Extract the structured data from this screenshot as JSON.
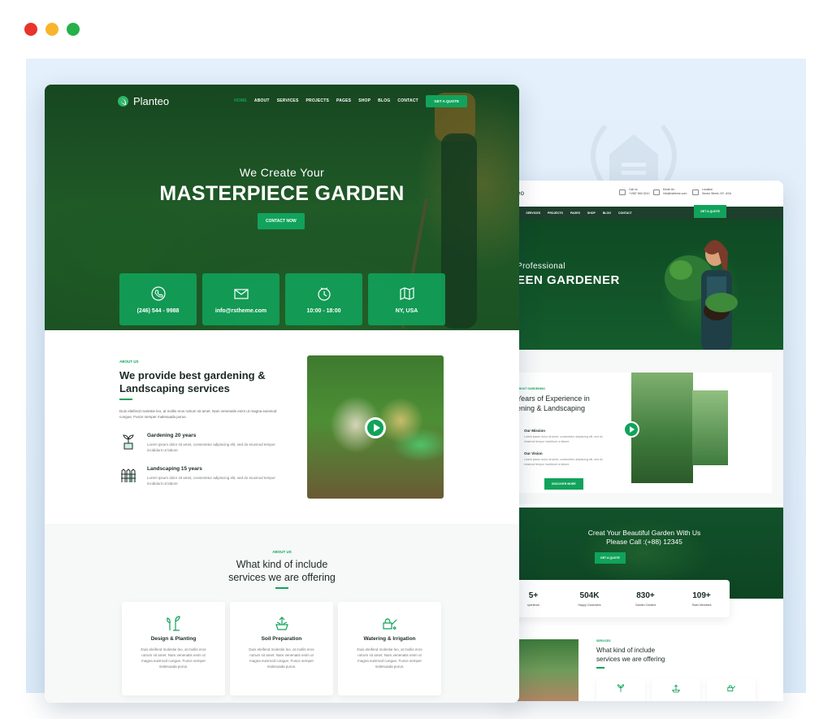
{
  "window": {
    "dots": [
      "#e9342b",
      "#f7b52c",
      "#26b14a"
    ]
  },
  "colors": {
    "accent": "#11a35b",
    "dark_green": "#0f4a24",
    "heading": "#1b2a24"
  },
  "main_site": {
    "brand": "Planteo",
    "nav": [
      "HOME",
      "ABOUT",
      "SERVICES",
      "PROJECTS",
      "PAGES",
      "SHOP",
      "BLOG",
      "CONTACT"
    ],
    "quote_button": "GET A QUOTE",
    "hero": {
      "subtitle": "We Create Your",
      "title": "MASTERPIECE GARDEN",
      "button": "CONTACT NOW"
    },
    "info_cards": [
      {
        "icon": "phone-icon",
        "text": "(246) 544 - 9988"
      },
      {
        "icon": "mail-icon",
        "text": "info@rstheme.com"
      },
      {
        "icon": "clock-icon",
        "text": "10:00 - 18:00"
      },
      {
        "icon": "map-icon",
        "text": "NY, USA"
      }
    ],
    "about": {
      "tag": "ABOUT US",
      "title": "We provide best gardening & Landscaping services",
      "text": "Duis eleifend molestie leo, at mollis eros rutrum sit amet. Nam venenatis enim ut magna euismod congue. Fusce semper malesuada purus.",
      "features": [
        {
          "icon": "plant-icon",
          "title": "Gardening 20 years",
          "text": "Lorem ipsum dolor sit amet, consectetur adipiscing elit, sed do eiusmod tempor incididunt ut labore"
        },
        {
          "icon": "fence-icon",
          "title": "Landscaping 15 years",
          "text": "Lorem ipsum dolor sit amet, consectetur adipiscing elit, sed do eiusmod tempor incididunt ut labore"
        }
      ]
    },
    "services": {
      "tag": "ABOUT US",
      "title_line1": "What kind of include",
      "title_line2": "services we are offering",
      "cards": [
        {
          "icon": "planting-icon",
          "title": "Design & Planting",
          "text": "Duis eleifend molestie leo, at mollis eros rutrum sit amet. Nam venenatis enim ut magna euismod congue. Fusce semper malesuada purus."
        },
        {
          "icon": "soil-icon",
          "title": "Soil Preparation",
          "text": "Duis eleifend molestie leo, at mollis eros rutrum sit amet. Nam venenatis enim ut magna euismod congue. Fusce semper malesuada purus."
        },
        {
          "icon": "watering-icon",
          "title": "Watering & Irrigation",
          "text": "Duis eleifend molestie leo, at mollis eros rutrum sit amet. Nam venenatis enim ut magna euismod congue. Fusce semper malesuada purus."
        }
      ]
    }
  },
  "second_site": {
    "brand": "eo",
    "topbar": [
      {
        "label": "Call us",
        "value": "+1987 654 3210"
      },
      {
        "label": "Email Us",
        "value": "info@rstheme.com"
      },
      {
        "label": "Location",
        "value": "Sector Street, NY, USA"
      }
    ],
    "nav": [
      "OUT",
      "SERVICES",
      "PROJECTS",
      "PAGES",
      "SHOP",
      "BLOG",
      "CONTACT"
    ],
    "quote_button": "GET A QUOTE",
    "hero": {
      "subtitle": "Professional",
      "title": "EEN GARDENER"
    },
    "about": {
      "tag": "ABOUT GARDENING",
      "title": "Years of Experience in ening & Landscaping",
      "mission_title": "Our Mission",
      "mission_text": "Lorem ipsum dolor sit amet, consectetur adipiscing elit, sed do eiusmod tempor incididunt ut labore",
      "vision_title": "Our Vision",
      "vision_text": "Lorem ipsum dolor sit amet, consectetur adipiscing elit, sed do eiusmod tempor incididunt ut labore",
      "button": "DISCOVER MORE"
    },
    "cta": {
      "line1": "Creat Your Beautiful Garden With Us",
      "line2": "Please Call :(+88) 12345",
      "button": "GET A QUOTE"
    },
    "stats": [
      {
        "value": "5+",
        "label": "xperience"
      },
      {
        "value": "504K",
        "label": "Happy Customers"
      },
      {
        "value": "830+",
        "label": "Garden Created"
      },
      {
        "value": "109+",
        "label": "Team Members"
      }
    ],
    "services": {
      "tag": "SERVICES",
      "title_line1": "What kind of include",
      "title_line2": "services we are offering"
    }
  }
}
